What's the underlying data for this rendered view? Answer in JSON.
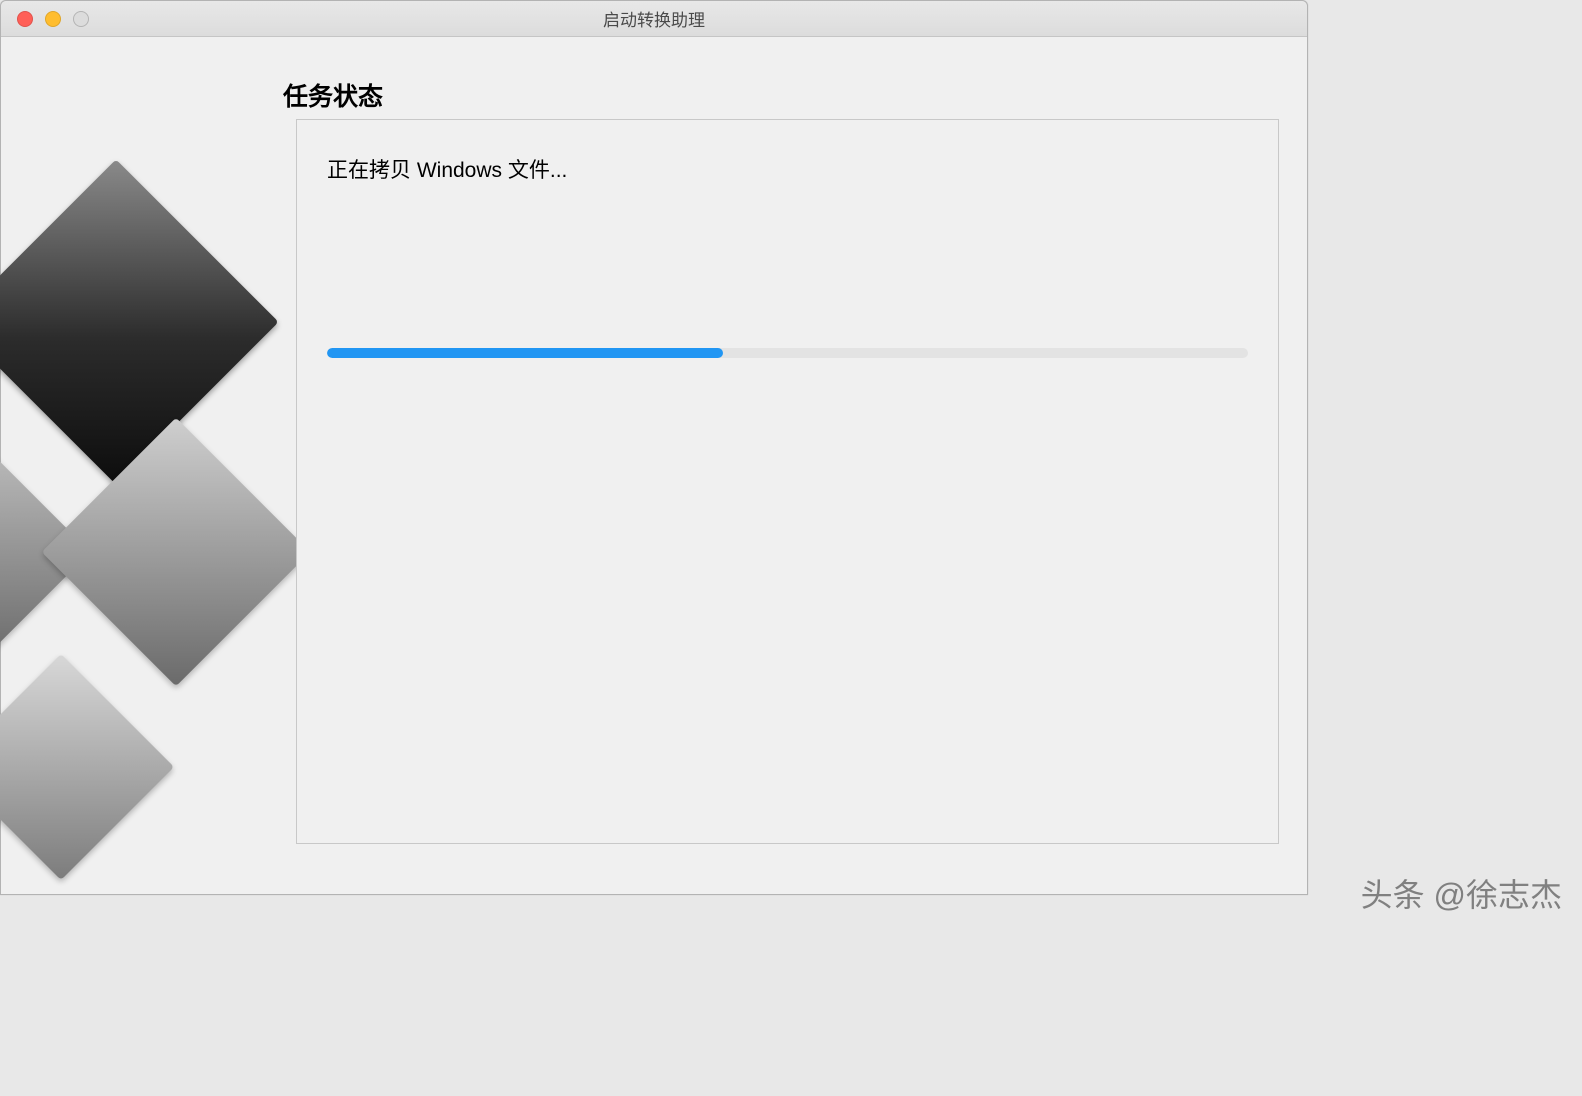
{
  "window": {
    "title": "启动转换助理"
  },
  "page": {
    "heading": "任务状态"
  },
  "status": {
    "message": "正在拷贝 Windows 文件..."
  },
  "progress": {
    "percent": 43
  },
  "watermark": {
    "text": "头条 @徐志杰"
  },
  "colors": {
    "accent": "#2196f3",
    "window_bg": "#f0f0f0",
    "border": "#c8c8c8"
  }
}
